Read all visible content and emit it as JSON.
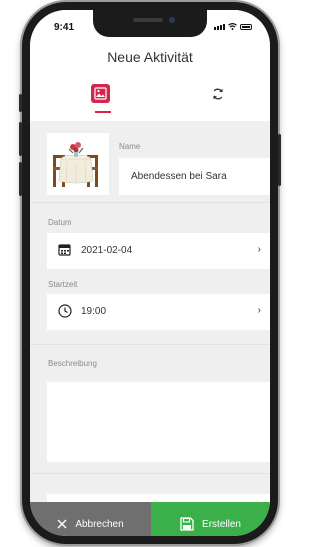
{
  "status_bar": {
    "time": "9:41"
  },
  "header": {
    "title": "Neue Aktivität"
  },
  "tabs": [
    {
      "icon": "image-gallery-icon",
      "active": true
    },
    {
      "icon": "refresh-icon",
      "active": false
    }
  ],
  "form": {
    "name": {
      "label": "Name",
      "value": "Abendessen bei Sara"
    },
    "date": {
      "label": "Datum",
      "value": "2021-02-04",
      "icon": "calendar-icon"
    },
    "start_time": {
      "label": "Startzeit",
      "value": "19:00",
      "icon": "clock-icon"
    },
    "description": {
      "label": "Beschreibung",
      "value": ""
    }
  },
  "actions": {
    "cancel_label": "Abbrechen",
    "create_label": "Erstellen"
  },
  "colors": {
    "accent": "#d6264f",
    "create": "#3bb04a",
    "cancel": "#6f6f6f",
    "background": "#efefef"
  }
}
